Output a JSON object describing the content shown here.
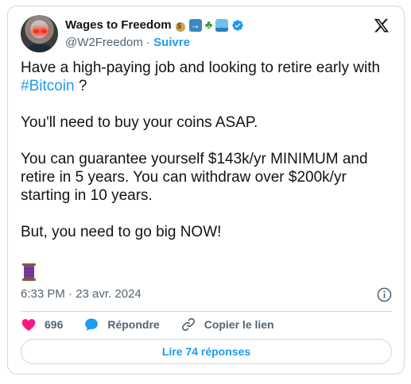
{
  "author": {
    "display_name": "Wages to Freedom",
    "name_emojis": [
      "money-bag",
      "right-arrow",
      "palm-tree",
      "surfer"
    ],
    "verified": true,
    "handle": "@W2Freedom",
    "separator": "·",
    "follow_label": "Suivre"
  },
  "tweet": {
    "paragraphs": [
      {
        "text": "Have a high-paying job and looking to retire early with ",
        "hashtag": "#Bitcoin",
        "suffix": " ?"
      },
      {
        "text": "You'll need to buy your coins ASAP."
      },
      {
        "text": "You can guarantee yourself $143k/yr MINIMUM and retire in 5 years. You can withdraw over $200k/yr starting in 10 years."
      },
      {
        "text": "But, you need to go big NOW!"
      }
    ],
    "trailing_emoji": "thread-spool",
    "timestamp": "6:33 PM · 23 avr. 2024"
  },
  "actions": {
    "likes_count": "696",
    "reply_label": "Répondre",
    "copy_link_label": "Copier le lien"
  },
  "read_replies_label": "Lire 74 réponses",
  "colors": {
    "accent": "#1d9bf0",
    "like": "#f91880",
    "muted": "#536471",
    "border": "#cfd9de"
  }
}
